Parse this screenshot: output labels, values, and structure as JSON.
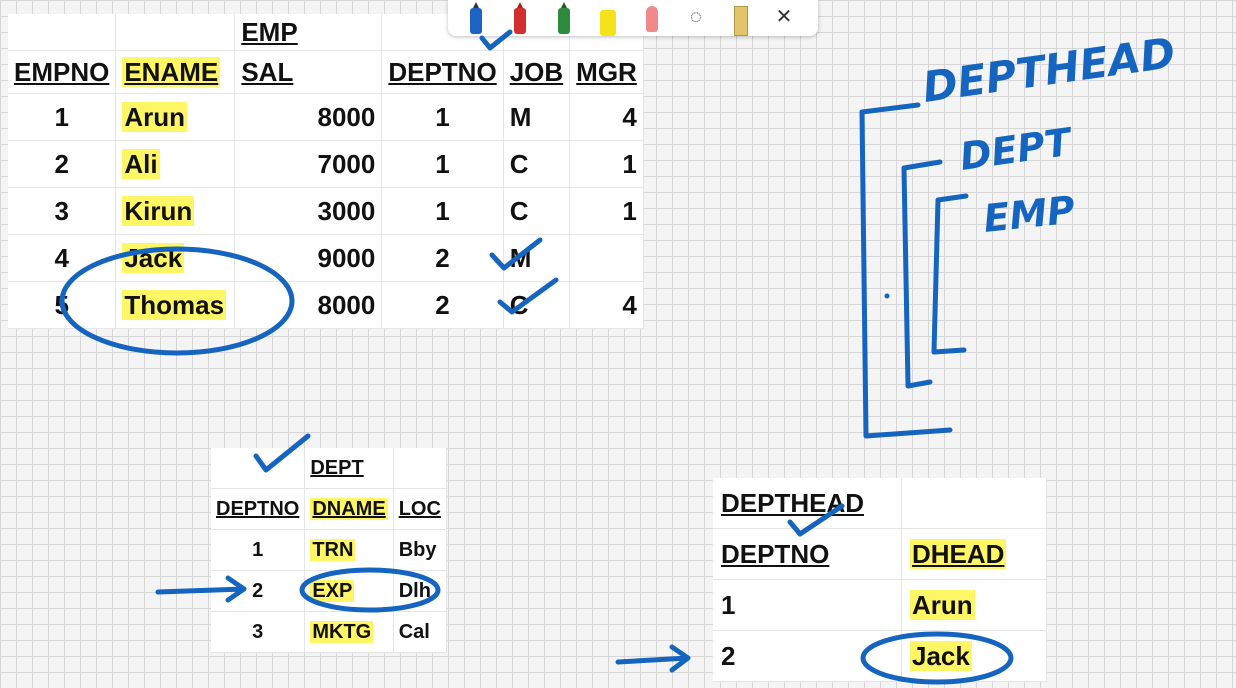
{
  "emp_table": {
    "title": "EMP",
    "headers": [
      "EMPNO",
      "ENAME",
      "SAL",
      "DEPTNO",
      "JOB",
      "MGR"
    ],
    "rows": [
      {
        "empno": "1",
        "ename": "Arun",
        "sal": "8000",
        "deptno": "1",
        "job": "M",
        "mgr": "4"
      },
      {
        "empno": "2",
        "ename": "Ali",
        "sal": "7000",
        "deptno": "1",
        "job": "C",
        "mgr": "1"
      },
      {
        "empno": "3",
        "ename": "Kirun",
        "sal": "3000",
        "deptno": "1",
        "job": "C",
        "mgr": "1"
      },
      {
        "empno": "4",
        "ename": "Jack",
        "sal": "9000",
        "deptno": "2",
        "job": "M",
        "mgr": ""
      },
      {
        "empno": "5",
        "ename": "Thomas",
        "sal": "8000",
        "deptno": "2",
        "job": "C",
        "mgr": "4"
      }
    ]
  },
  "dept_table": {
    "title": "DEPT",
    "headers": [
      "DEPTNO",
      "DNAME",
      "LOC"
    ],
    "rows": [
      {
        "deptno": "1",
        "dname": "TRN",
        "loc": "Bby"
      },
      {
        "deptno": "2",
        "dname": "EXP",
        "loc": "Dlh"
      },
      {
        "deptno": "3",
        "dname": "MKTG",
        "loc": "Cal"
      }
    ]
  },
  "depthead_table": {
    "title": "DEPTHEAD",
    "headers": [
      "DEPTNO",
      "DHEAD"
    ],
    "rows": [
      {
        "deptno": "1",
        "dhead": "Arun"
      },
      {
        "deptno": "2",
        "dhead": "Jack"
      }
    ]
  },
  "ink_notes": {
    "depthead": "DEPTHEAD",
    "dept": "DEPT",
    "emp": "EMP"
  },
  "toolbar": {
    "tools": [
      "ballpoint-pen-icon",
      "red-pen-icon",
      "green-pen-icon",
      "highlighter-icon",
      "eraser-icon",
      "lasso-icon",
      "ruler-icon",
      "close-icon"
    ],
    "close_glyph": "✕",
    "pen_colors": {
      "blue": "#1e63c4",
      "red": "#d32f2f",
      "green": "#2e8b3e",
      "highlighter": "#f6e21a",
      "eraser": "#f08a8a"
    }
  },
  "colors": {
    "ink": "#1565c0",
    "highlight": "#fff332"
  }
}
